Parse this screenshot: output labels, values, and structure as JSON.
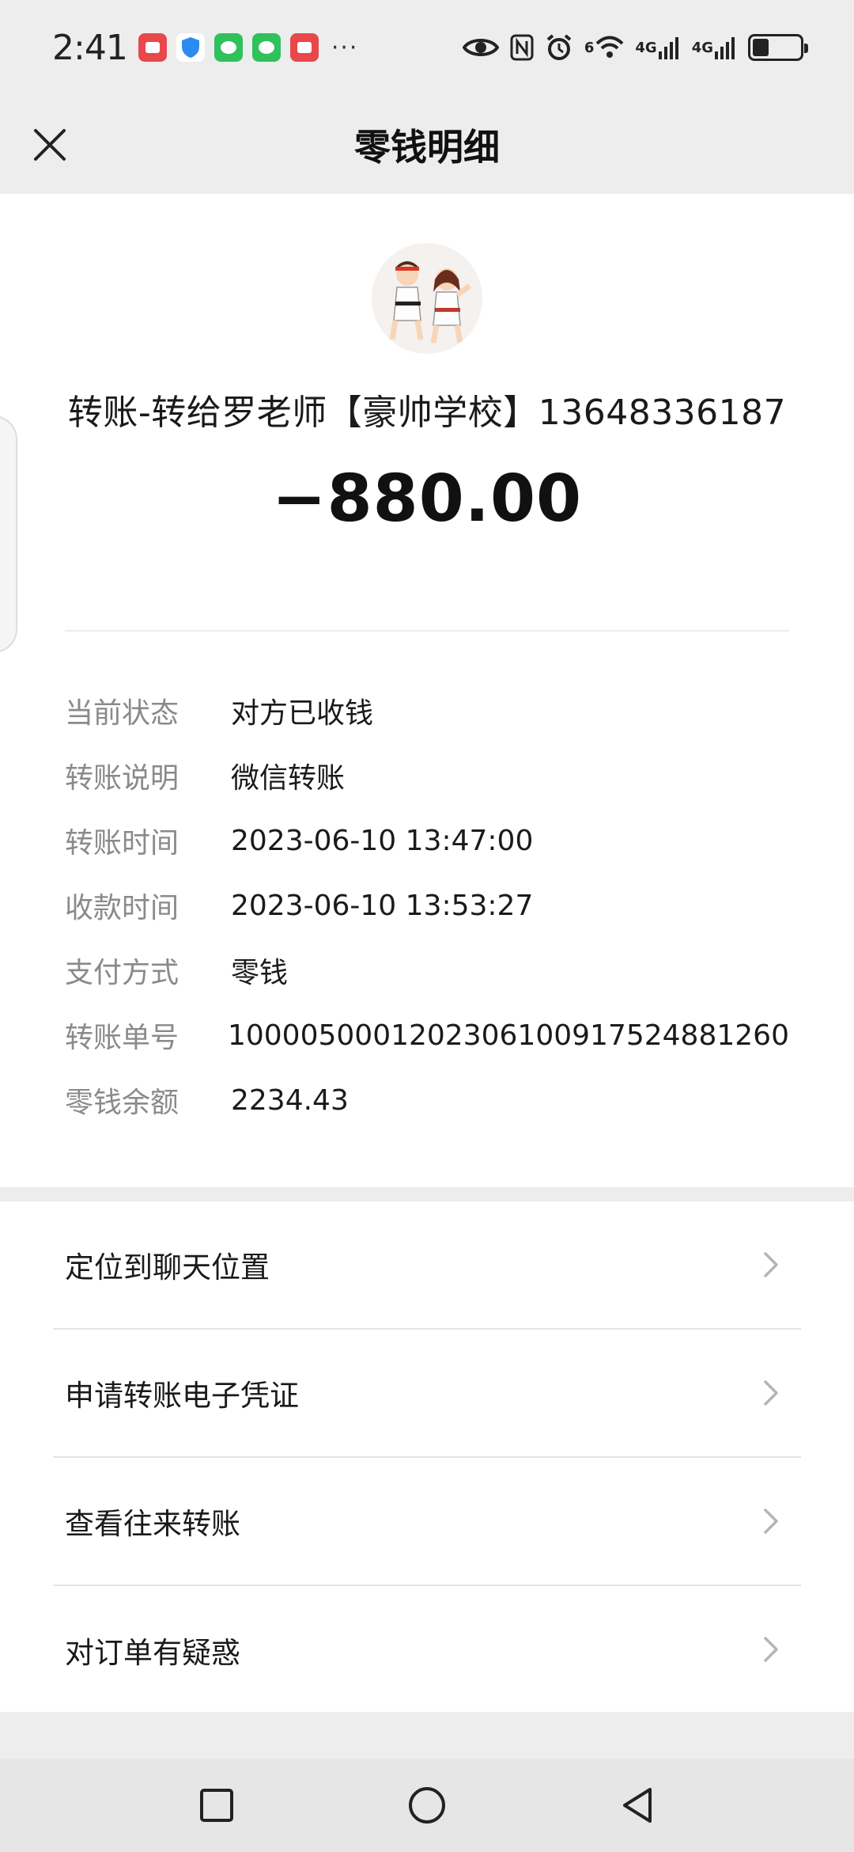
{
  "status_bar": {
    "time": "2:41",
    "more": "···",
    "net1": "6",
    "net2": "4G",
    "net3": "4G"
  },
  "nav": {
    "title": "零钱明细"
  },
  "transaction": {
    "payee": "转账-转给罗老师【豪帅学校】13648336187",
    "amount": "−880.00"
  },
  "details": [
    {
      "label": "当前状态",
      "value": "对方已收钱"
    },
    {
      "label": "转账说明",
      "value": "微信转账"
    },
    {
      "label": "转账时间",
      "value": "2023-06-10 13:47:00"
    },
    {
      "label": "收款时间",
      "value": "2023-06-10 13:53:27"
    },
    {
      "label": "支付方式",
      "value": "零钱"
    },
    {
      "label": "转账单号",
      "value": "1000050001202306100917524881260"
    },
    {
      "label": "零钱余额",
      "value": "2234.43"
    }
  ],
  "actions": [
    {
      "label": "定位到聊天位置"
    },
    {
      "label": "申请转账电子凭证"
    },
    {
      "label": "查看往来转账"
    },
    {
      "label": "对订单有疑惑"
    }
  ],
  "colors": {
    "background": "#ededed",
    "card": "#ffffff",
    "label_gray": "#8a8a8a",
    "wechat_green": "#2fc25b"
  }
}
